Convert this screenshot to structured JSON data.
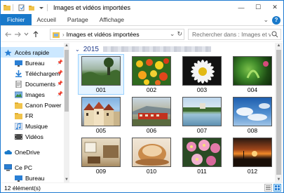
{
  "window": {
    "title": "Images et vidéos importées",
    "controls": {
      "minimize": "—",
      "maximize": "☐",
      "close": "✕"
    }
  },
  "ribbon": {
    "tabs": [
      "Fichier",
      "Accueil",
      "Partage",
      "Affichage"
    ],
    "collapse": "⌄",
    "help": "?"
  },
  "address": {
    "path": "Images et vidéos importées",
    "search_placeholder": "Rechercher dans : Images et v..."
  },
  "navpane": {
    "items": [
      {
        "label": "Accès rapide",
        "icon": "star-icon",
        "pinned": false
      },
      {
        "label": "Bureau",
        "icon": "desktop-icon",
        "pinned": true
      },
      {
        "label": "Téléchargem",
        "icon": "download-icon",
        "pinned": true
      },
      {
        "label": "Documents",
        "icon": "documents-icon",
        "pinned": true
      },
      {
        "label": "Images",
        "icon": "pictures-icon",
        "pinned": true
      },
      {
        "label": "Canon Power",
        "icon": "folder-icon",
        "pinned": false
      },
      {
        "label": "FR",
        "icon": "folder-icon",
        "pinned": false
      },
      {
        "label": "Musique",
        "icon": "music-icon",
        "pinned": false
      },
      {
        "label": "Vidéos",
        "icon": "videos-icon",
        "pinned": false
      },
      {
        "label": "OneDrive",
        "icon": "onedrive-icon",
        "pinned": false
      },
      {
        "label": "Ce PC",
        "icon": "computer-icon",
        "pinned": false
      },
      {
        "label": "Bureau",
        "icon": "desktop-icon",
        "pinned": false
      }
    ]
  },
  "content": {
    "group_title": "2015",
    "items": [
      {
        "label": "001",
        "icon": "landscape-photo-icon",
        "selected": true
      },
      {
        "label": "002",
        "icon": "flowers-photo-icon",
        "selected": false
      },
      {
        "label": "003",
        "icon": "daisy-photo-icon",
        "selected": false
      },
      {
        "label": "004",
        "icon": "plant-photo-icon",
        "selected": false
      },
      {
        "label": "005",
        "icon": "houses-photo-icon",
        "selected": false
      },
      {
        "label": "006",
        "icon": "train-photo-icon",
        "selected": false
      },
      {
        "label": "007",
        "icon": "pond-photo-icon",
        "selected": false
      },
      {
        "label": "008",
        "icon": "sky-photo-icon",
        "selected": false
      },
      {
        "label": "009",
        "icon": "interior-photo-icon",
        "selected": false
      },
      {
        "label": "010",
        "icon": "bowls-photo-icon",
        "selected": false
      },
      {
        "label": "011",
        "icon": "pink-flowers-photo-icon",
        "selected": false
      },
      {
        "label": "012",
        "icon": "sunset-photo-icon",
        "selected": false
      }
    ]
  },
  "status": {
    "count": "12 élément(s)"
  },
  "colors": {
    "accent": "#1979ca",
    "selection": "#cce8ff",
    "group_title": "#1e3a8a"
  }
}
